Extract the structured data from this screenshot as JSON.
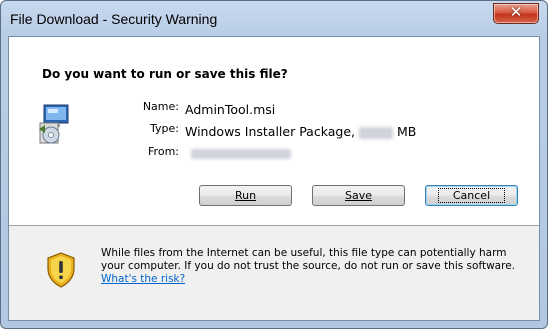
{
  "window": {
    "title": "File Download - Security Warning"
  },
  "dialog": {
    "question": "Do you want to run or save this file?",
    "name_label": "Name:",
    "name_value": "AdminTool.msi",
    "type_label": "Type:",
    "type_value_prefix": "Windows Installer Package,",
    "type_value_suffix": "MB",
    "from_label": "From:",
    "buttons": {
      "run": "Run",
      "save": "Save",
      "cancel": "Cancel"
    },
    "warning_text": "While files from the Internet can be useful, this file type can potentially harm your computer. If you do not trust the source, do not run or save this software.",
    "risk_link": "What's the risk?"
  },
  "icons": [
    "close-icon",
    "installer-file-icon",
    "security-shield-icon"
  ],
  "colors": {
    "titlebar": "#b9cde6",
    "close": "#c7432a",
    "link": "#0066cc",
    "footer": "#f0f0f0"
  }
}
